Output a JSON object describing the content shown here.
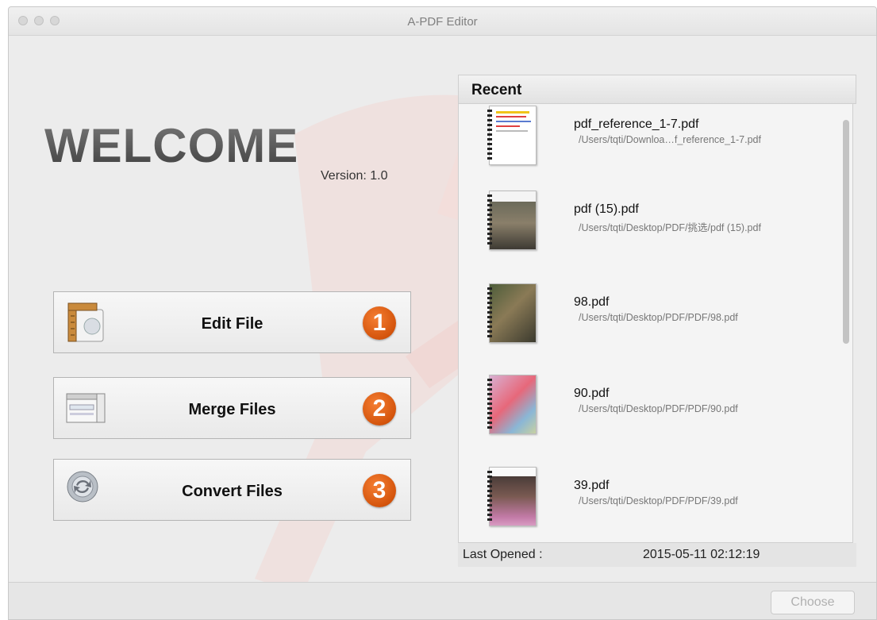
{
  "window": {
    "title": "A-PDF Editor"
  },
  "welcome": {
    "heading": "WELCOME",
    "version": "Version: 1.0"
  },
  "actions": [
    {
      "label": "Edit File",
      "step": "1",
      "icon": "edit-file-icon"
    },
    {
      "label": "Merge Files",
      "step": "2",
      "icon": "merge-files-icon"
    },
    {
      "label": "Convert Files",
      "step": "3",
      "icon": "convert-files-icon"
    }
  ],
  "recent": {
    "header": "Recent",
    "items": [
      {
        "name": "pdf_reference_1-7.pdf",
        "path": "/Users/tqti/Downloa…f_reference_1-7.pdf"
      },
      {
        "name": "pdf (15).pdf",
        "path": "/Users/tqti/Desktop/PDF/挑选/pdf (15).pdf"
      },
      {
        "name": "98.pdf",
        "path": "/Users/tqti/Desktop/PDF/PDF/98.pdf"
      },
      {
        "name": "90.pdf",
        "path": "/Users/tqti/Desktop/PDF/PDF/90.pdf"
      },
      {
        "name": "39.pdf",
        "path": "/Users/tqti/Desktop/PDF/PDF/39.pdf"
      }
    ],
    "last_opened_label": "Last Opened :",
    "last_opened_value": "2015-05-11 02:12:19"
  },
  "bottom": {
    "choose_label": "Choose"
  },
  "colors": {
    "badge": "#e0621a",
    "accent_watermark": "#f0b7b3"
  }
}
